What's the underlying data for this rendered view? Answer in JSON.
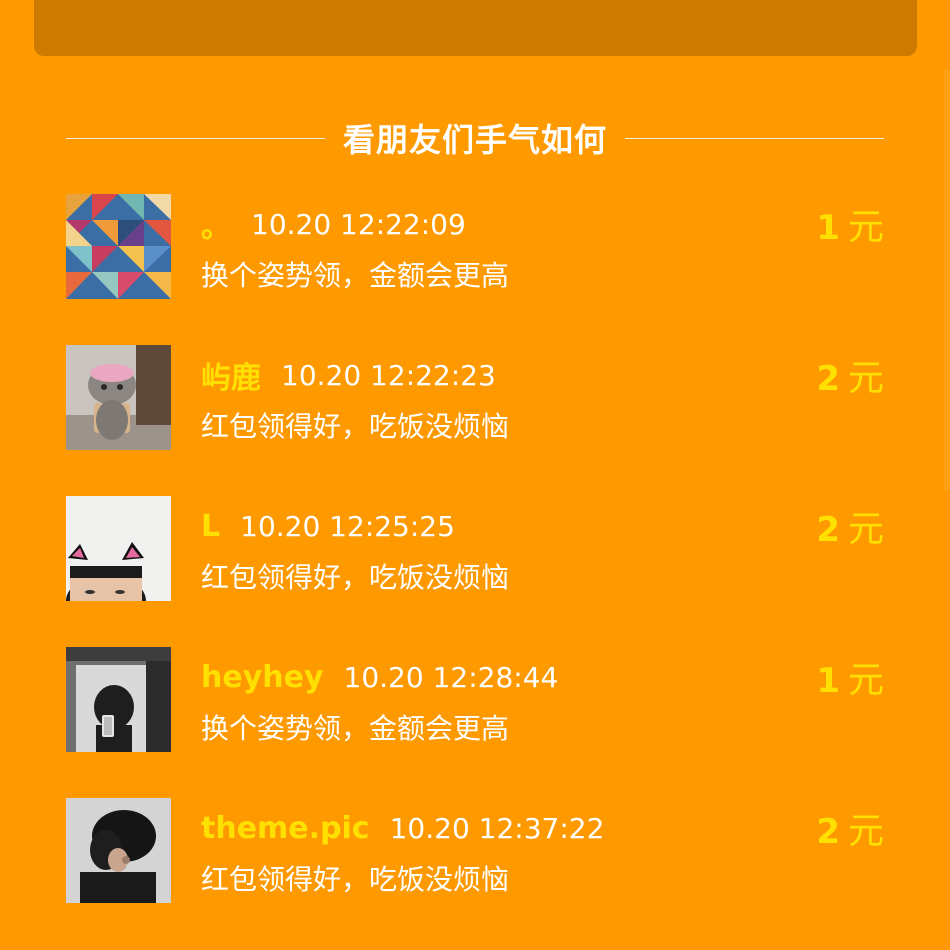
{
  "section": {
    "title": "看朋友们手气如何"
  },
  "entries": [
    {
      "name": "。",
      "time": "10.20 12:22:09",
      "message": "换个姿势领，金额会更高",
      "amount": "1",
      "unit": "元"
    },
    {
      "name": "屿鹿",
      "time": "10.20 12:22:23",
      "message": "红包领得好，吃饭没烦恼",
      "amount": "2",
      "unit": "元"
    },
    {
      "name": "L",
      "time": "10.20 12:25:25",
      "message": "红包领得好，吃饭没烦恼",
      "amount": "2",
      "unit": "元"
    },
    {
      "name": "heyhey",
      "time": "10.20 12:28:44",
      "message": "换个姿势领，金额会更高",
      "amount": "1",
      "unit": "元"
    },
    {
      "name": "theme.pic",
      "time": "10.20 12:37:22",
      "message": "红包领得好，吃饭没烦恼",
      "amount": "2",
      "unit": "元"
    }
  ],
  "colors": {
    "background": "#FF9900",
    "card": "#CC7A00",
    "name": "#FFE000",
    "amount": "#FFE000",
    "text": "#FFFFFF"
  }
}
